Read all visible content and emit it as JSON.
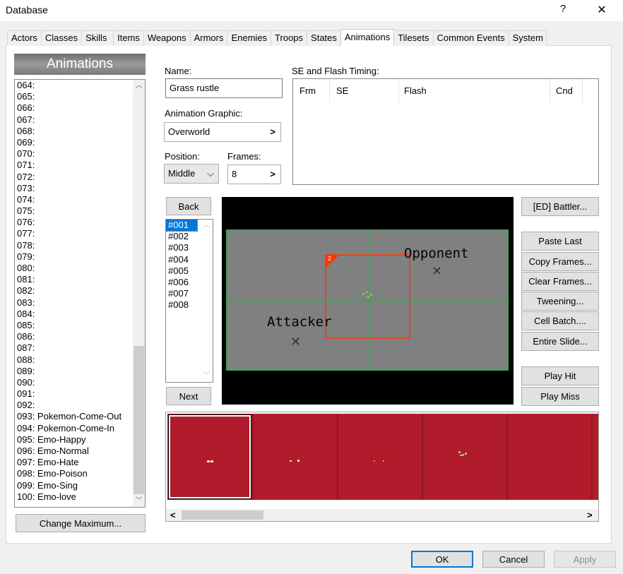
{
  "window": {
    "title": "Database",
    "help_glyph": "?",
    "close_glyph": "✕"
  },
  "tabs": [
    "Actors",
    "Classes",
    "Skills",
    "Items",
    "Weapons",
    "Armors",
    "Enemies",
    "Troops",
    "States",
    "Animations",
    "Tilesets",
    "Common Events",
    "System"
  ],
  "active_tab": "Animations",
  "sidebar": {
    "header": "Animations",
    "items": [
      "064:",
      "065:",
      "066:",
      "067:",
      "068:",
      "069:",
      "070:",
      "071:",
      "072:",
      "073:",
      "074:",
      "075:",
      "076:",
      "077:",
      "078:",
      "079:",
      "080:",
      "081:",
      "082:",
      "083:",
      "084:",
      "085:",
      "086:",
      "087:",
      "088:",
      "089:",
      "090:",
      "091:",
      "092:",
      "093: Pokemon-Come-Out",
      "094: Pokemon-Come-In",
      "095: Emo-Happy",
      "096: Emo-Normal",
      "097: Emo-Hate",
      "098: Emo-Poison",
      "099: Emo-Sing",
      "100: Emo-love"
    ],
    "change_max_label": "Change Maximum..."
  },
  "form": {
    "name_label": "Name:",
    "name_value": "Grass rustle",
    "graphic_label": "Animation Graphic:",
    "graphic_value": "Overworld",
    "position_label": "Position:",
    "position_value": "Middle",
    "frames_label": "Frames:",
    "frames_value": "8",
    "picker_arrow": ">",
    "dropdown_arrow": "⌵"
  },
  "timing": {
    "label": "SE and Flash Timing:",
    "columns": [
      "Frm",
      "SE",
      "Flash",
      "Cnd"
    ]
  },
  "frames": {
    "back_label": "Back",
    "next_label": "Next",
    "items": [
      "#001",
      "#002",
      "#003",
      "#004",
      "#005",
      "#006",
      "#007",
      "#008"
    ],
    "selected": "#001"
  },
  "stage": {
    "opponent_label": "Opponent",
    "attacker_label": "Attacker",
    "cell_number": "2",
    "target_marker": "✕"
  },
  "tools": {
    "battler_label": "[ED] Battler...",
    "paste_last_label": "Paste Last",
    "copy_frames_label": "Copy Frames...",
    "clear_frames_label": "Clear Frames...",
    "tweening_label": "Tweening...",
    "cell_batch_label": "Cell Batch....",
    "entire_slide_label": "Entire Slide...",
    "play_hit_label": "Play Hit",
    "play_miss_label": "Play Miss"
  },
  "cell_palette": {
    "color": "#b01c2b",
    "scroll_left": "<",
    "scroll_right": ">"
  },
  "footer": {
    "ok_label": "OK",
    "cancel_label": "Cancel",
    "apply_label": "Apply"
  },
  "colors": {
    "accent": "#0078d7",
    "stage_bg": "#808080",
    "grid_line": "#22b14c",
    "cell_outline": "#ff3300",
    "palette_red": "#b01c2b"
  }
}
